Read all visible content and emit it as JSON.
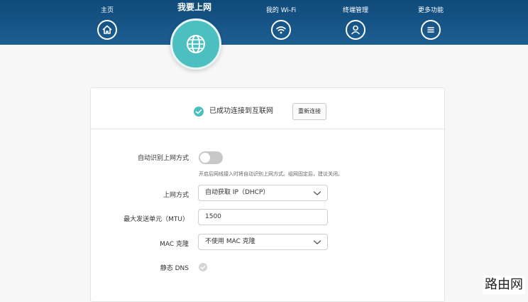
{
  "nav": {
    "items": [
      {
        "label": "主页",
        "icon": "home-icon"
      },
      {
        "label": "我要上网",
        "icon": "globe-icon",
        "active": true
      },
      {
        "label": "我的 Wi-Fi",
        "icon": "wifi-icon"
      },
      {
        "label": "终端管理",
        "icon": "user-icon"
      },
      {
        "label": "更多功能",
        "icon": "menu-icon"
      }
    ]
  },
  "status": {
    "text": "已成功连接到互联网",
    "reconnect_label": "重新连接"
  },
  "form": {
    "auto_detect": {
      "label": "自动识别上网方式",
      "enabled": false,
      "hint": "开启后网线接入时将自动识别上网方式。组网固定后，建议关闭。"
    },
    "access_mode": {
      "label": "上网方式",
      "value": "自动获取 IP（DHCP）"
    },
    "mtu": {
      "label": "最大发送单元（MTU）",
      "value": "1500"
    },
    "mac_clone": {
      "label": "MAC 克隆",
      "value": "不使用 MAC 克隆"
    },
    "static_dns": {
      "label": "静态 DNS"
    }
  },
  "watermark": "路由网",
  "colors": {
    "topbar": "#1d5e91",
    "accent": "#4cbfc0"
  }
}
